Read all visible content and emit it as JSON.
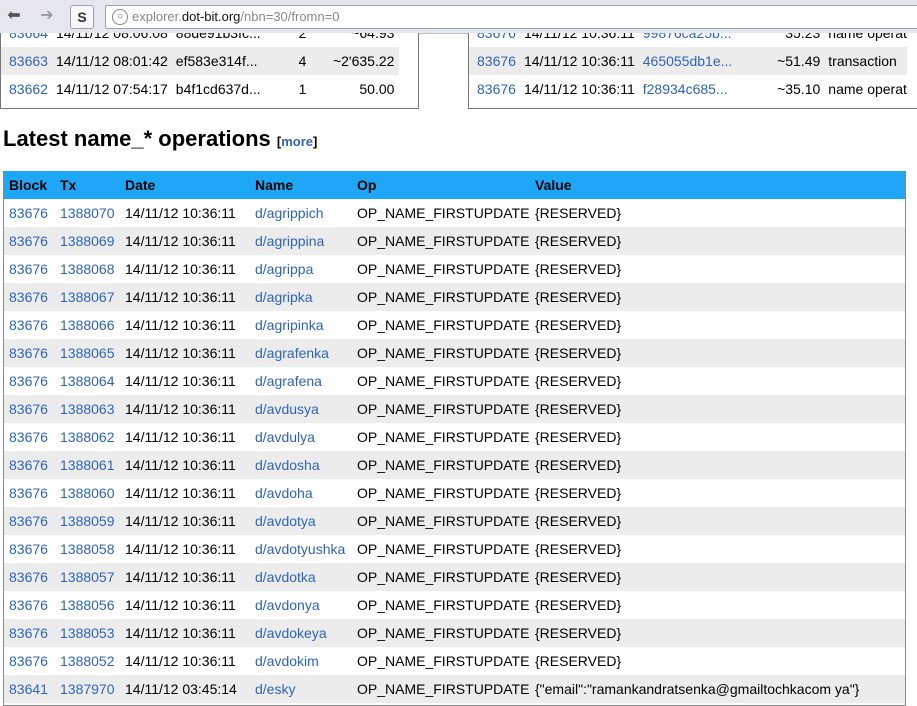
{
  "browser": {
    "url_prefix": "explorer.",
    "url_domain": "dot-bit.org",
    "url_path": "/nbn=30/fromn=0"
  },
  "left_box": {
    "rows": [
      {
        "block": "83664",
        "date": "14/11/12 08:06:08",
        "hash": "88de91b3fc...",
        "count": "2",
        "amount": "~64.93"
      },
      {
        "block": "83663",
        "date": "14/11/12 08:01:42",
        "hash": "ef583e314f...",
        "count": "4",
        "amount": "~2'635.22"
      },
      {
        "block": "83662",
        "date": "14/11/12 07:54:17",
        "hash": "b4f1cd637d...",
        "count": "1",
        "amount": "50.00"
      }
    ]
  },
  "right_box": {
    "rows": [
      {
        "block": "83676",
        "date": "14/11/12 10:36:11",
        "hash": "99876ca25b...",
        "amount": "35.23",
        "type": "name operat"
      },
      {
        "block": "83676",
        "date": "14/11/12 10:36:11",
        "hash": "465055db1e...",
        "amount": "~51.49",
        "type": "transaction"
      },
      {
        "block": "83676",
        "date": "14/11/12 10:36:11",
        "hash": "f28934c685...",
        "amount": "~35.10",
        "type": "name operat"
      }
    ]
  },
  "section": {
    "title": "Latest name_* operations",
    "more_open": "[",
    "more_label": "more",
    "more_close": "]"
  },
  "table": {
    "headers": {
      "block": "Block",
      "tx": "Tx",
      "date": "Date",
      "name": "Name",
      "op": "Op",
      "value": "Value"
    },
    "rows": [
      {
        "block": "83676",
        "tx": "1388070",
        "date": "14/11/12 10:36:11",
        "name": "d/agrippich",
        "op": "OP_NAME_FIRSTUPDATE",
        "value": "{RESERVED}"
      },
      {
        "block": "83676",
        "tx": "1388069",
        "date": "14/11/12 10:36:11",
        "name": "d/agrippina",
        "op": "OP_NAME_FIRSTUPDATE",
        "value": "{RESERVED}"
      },
      {
        "block": "83676",
        "tx": "1388068",
        "date": "14/11/12 10:36:11",
        "name": "d/agrippa",
        "op": "OP_NAME_FIRSTUPDATE",
        "value": "{RESERVED}"
      },
      {
        "block": "83676",
        "tx": "1388067",
        "date": "14/11/12 10:36:11",
        "name": "d/agripka",
        "op": "OP_NAME_FIRSTUPDATE",
        "value": "{RESERVED}"
      },
      {
        "block": "83676",
        "tx": "1388066",
        "date": "14/11/12 10:36:11",
        "name": "d/agripinka",
        "op": "OP_NAME_FIRSTUPDATE",
        "value": "{RESERVED}"
      },
      {
        "block": "83676",
        "tx": "1388065",
        "date": "14/11/12 10:36:11",
        "name": "d/agrafenka",
        "op": "OP_NAME_FIRSTUPDATE",
        "value": "{RESERVED}"
      },
      {
        "block": "83676",
        "tx": "1388064",
        "date": "14/11/12 10:36:11",
        "name": "d/agrafena",
        "op": "OP_NAME_FIRSTUPDATE",
        "value": "{RESERVED}"
      },
      {
        "block": "83676",
        "tx": "1388063",
        "date": "14/11/12 10:36:11",
        "name": "d/avdusya",
        "op": "OP_NAME_FIRSTUPDATE",
        "value": "{RESERVED}"
      },
      {
        "block": "83676",
        "tx": "1388062",
        "date": "14/11/12 10:36:11",
        "name": "d/avdulya",
        "op": "OP_NAME_FIRSTUPDATE",
        "value": "{RESERVED}"
      },
      {
        "block": "83676",
        "tx": "1388061",
        "date": "14/11/12 10:36:11",
        "name": "d/avdosha",
        "op": "OP_NAME_FIRSTUPDATE",
        "value": "{RESERVED}"
      },
      {
        "block": "83676",
        "tx": "1388060",
        "date": "14/11/12 10:36:11",
        "name": "d/avdoha",
        "op": "OP_NAME_FIRSTUPDATE",
        "value": "{RESERVED}"
      },
      {
        "block": "83676",
        "tx": "1388059",
        "date": "14/11/12 10:36:11",
        "name": "d/avdotya",
        "op": "OP_NAME_FIRSTUPDATE",
        "value": "{RESERVED}"
      },
      {
        "block": "83676",
        "tx": "1388058",
        "date": "14/11/12 10:36:11",
        "name": "d/avdotyushka",
        "op": "OP_NAME_FIRSTUPDATE",
        "value": "{RESERVED}"
      },
      {
        "block": "83676",
        "tx": "1388057",
        "date": "14/11/12 10:36:11",
        "name": "d/avdotka",
        "op": "OP_NAME_FIRSTUPDATE",
        "value": "{RESERVED}"
      },
      {
        "block": "83676",
        "tx": "1388056",
        "date": "14/11/12 10:36:11",
        "name": "d/avdonya",
        "op": "OP_NAME_FIRSTUPDATE",
        "value": "{RESERVED}"
      },
      {
        "block": "83676",
        "tx": "1388053",
        "date": "14/11/12 10:36:11",
        "name": "d/avdokeya",
        "op": "OP_NAME_FIRSTUPDATE",
        "value": "{RESERVED}"
      },
      {
        "block": "83676",
        "tx": "1388052",
        "date": "14/11/12 10:36:11",
        "name": "d/avdokim",
        "op": "OP_NAME_FIRSTUPDATE",
        "value": "{RESERVED}"
      },
      {
        "block": "83641",
        "tx": "1387970",
        "date": "14/11/12 03:45:14",
        "name": "d/esky",
        "op": "OP_NAME_FIRSTUPDATE",
        "value": "{\"email\":\"ramankandratsenka@gmailtochkacom ya\"}"
      }
    ]
  },
  "colors": {
    "header_bg": "#1ea7f7",
    "link": "#2e64b6",
    "alt_row": "#ececec"
  },
  "icons": [
    "back-arrow-icon",
    "forward-arrow-icon",
    "reload-icon",
    "globe-icon"
  ]
}
